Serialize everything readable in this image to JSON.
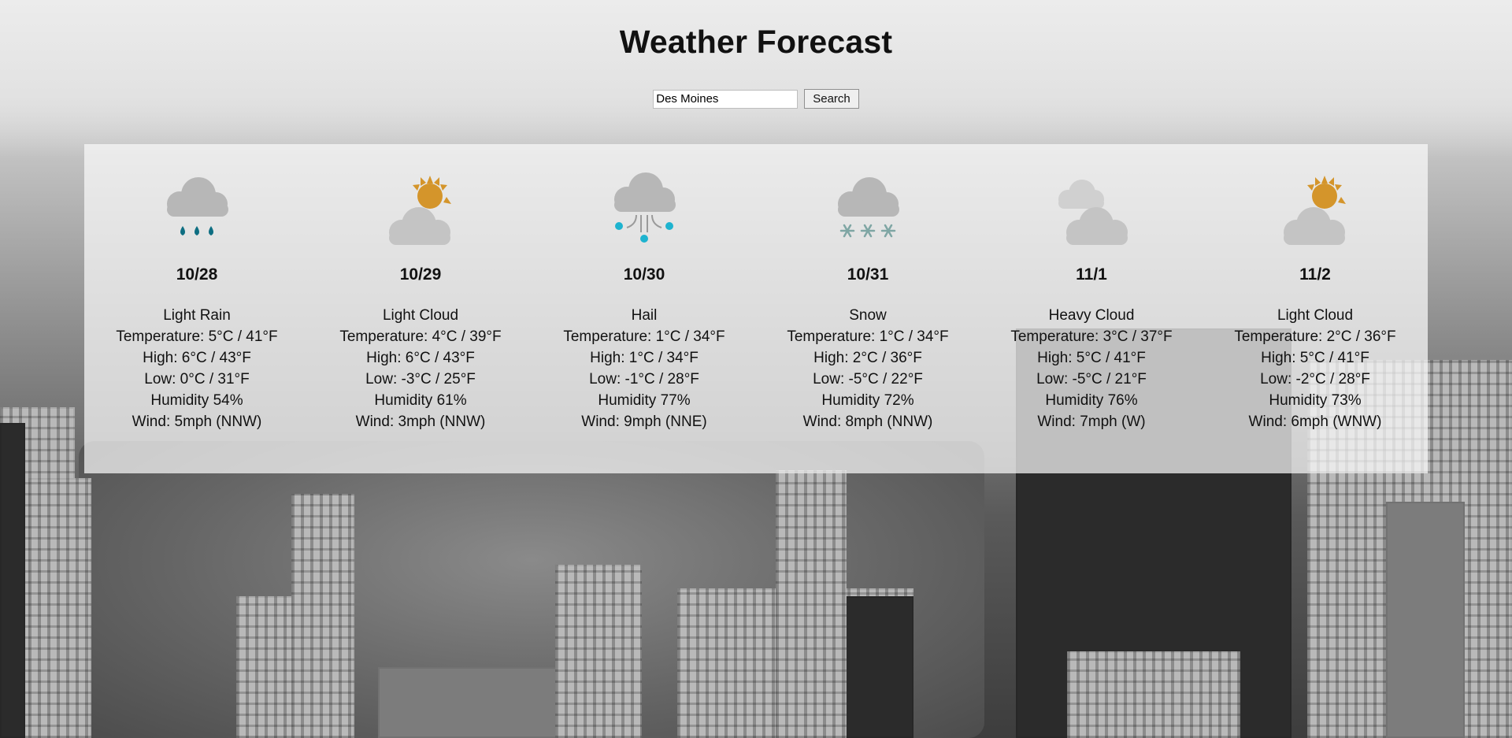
{
  "page": {
    "title": "Weather Forecast"
  },
  "search": {
    "value": "Des Moines",
    "button_label": "Search"
  },
  "forecast": [
    {
      "icon": "rain-icon",
      "date": "10/28",
      "condition": "Light Rain",
      "temperature": "Temperature: 5°C / 41°F",
      "high": "High: 6°C / 43°F",
      "low": "Low: 0°C / 31°F",
      "humidity": "Humidity 54%",
      "wind": "Wind: 5mph (NNW)"
    },
    {
      "icon": "sun-cloud-icon",
      "date": "10/29",
      "condition": "Light Cloud",
      "temperature": "Temperature: 4°C / 39°F",
      "high": "High: 6°C / 43°F",
      "low": "Low: -3°C / 25°F",
      "humidity": "Humidity 61%",
      "wind": "Wind: 3mph (NNW)"
    },
    {
      "icon": "hail-icon",
      "date": "10/30",
      "condition": "Hail",
      "temperature": "Temperature: 1°C / 34°F",
      "high": "High: 1°C / 34°F",
      "low": "Low: -1°C / 28°F",
      "humidity": "Humidity 77%",
      "wind": "Wind: 9mph (NNE)"
    },
    {
      "icon": "snow-icon",
      "date": "10/31",
      "condition": "Snow",
      "temperature": "Temperature: 1°C / 34°F",
      "high": "High: 2°C / 36°F",
      "low": "Low: -5°C / 22°F",
      "humidity": "Humidity 72%",
      "wind": "Wind: 8mph (NNW)"
    },
    {
      "icon": "heavy-cloud-icon",
      "date": "11/1",
      "condition": "Heavy Cloud",
      "temperature": "Temperature: 3°C / 37°F",
      "high": "High: 5°C / 41°F",
      "low": "Low: -5°C / 21°F",
      "humidity": "Humidity 76%",
      "wind": "Wind: 7mph (W)"
    },
    {
      "icon": "sun-cloud-icon",
      "date": "11/2",
      "condition": "Light Cloud",
      "temperature": "Temperature: 2°C / 36°F",
      "high": "High: 5°C / 41°F",
      "low": "Low: -2°C / 28°F",
      "humidity": "Humidity 73%",
      "wind": "Wind: 6mph (WNW)"
    }
  ],
  "colors": {
    "sun": "#d4952b",
    "cloud": "#b7b7b7",
    "rain": "#0e6e82",
    "hail": "#1eb3cf",
    "snow": "#7fa6a4"
  }
}
